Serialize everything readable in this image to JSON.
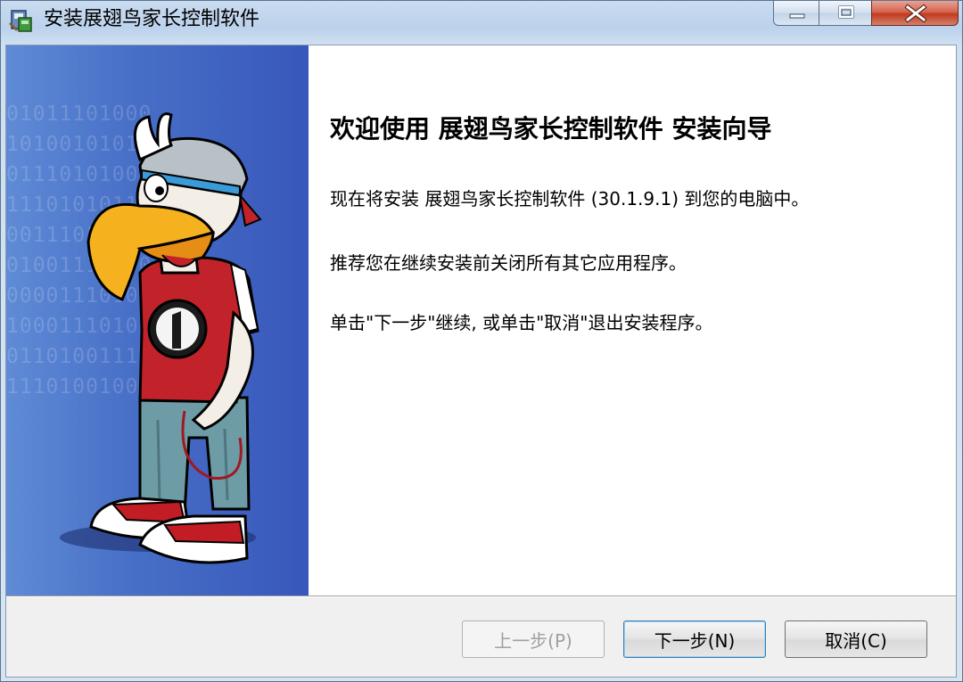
{
  "window": {
    "title": "安装展翅鸟家长控制软件"
  },
  "title_controls": {
    "minimize_icon": "minimize-icon",
    "maximize_icon": "maximize-icon",
    "close_icon": "close-icon"
  },
  "side_panel": {
    "binary_lines": [
      "01011101000",
      "10100101011",
      "01110101001",
      "11101010110",
      "00111010101",
      "01001110100",
      "00001110101",
      "10001110100",
      "01101001110",
      "11101001000"
    ]
  },
  "content": {
    "heading": "欢迎使用 展翅鸟家长控制软件 安装向导",
    "line1": "现在将安装 展翅鸟家长控制软件 (30.1.9.1) 到您的电脑中。",
    "line2": "推荐您在继续安装前关闭所有其它应用程序。",
    "line3": "单击\"下一步\"继续, 或单击\"取消\"退出安装程序。"
  },
  "buttons": {
    "back": "上一步(P)",
    "next": "下一步(N)",
    "cancel": "取消(C)"
  },
  "colors": {
    "side_panel": "#4870c7",
    "close_button": "#c23a1f"
  }
}
